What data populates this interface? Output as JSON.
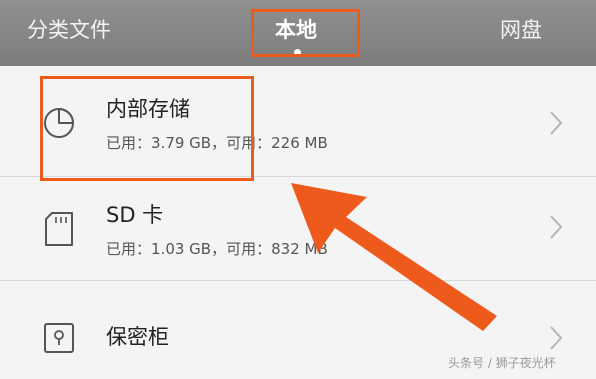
{
  "tabs": {
    "category": "分类文件",
    "local": "本地",
    "cloud": "网盘"
  },
  "storage_items": [
    {
      "title": "内部存储",
      "used_label": "已用：",
      "used": "3.79 GB",
      "sep": "，",
      "avail_label": "可用：",
      "available": "226 MB",
      "icon": "pie-chart-icon"
    },
    {
      "title": "SD 卡",
      "used_label": "已用：",
      "used": "1.03 GB",
      "sep": "，",
      "avail_label": "可用：",
      "available": "832 MB",
      "icon": "sd-card-icon"
    },
    {
      "title": "保密柜",
      "icon": "safe-lock-icon"
    }
  ],
  "watermark": "头条号 / 狮子夜光杯",
  "colors": {
    "topbar": "#858585",
    "highlight": "#ee5a1c",
    "background": "#f4f4f4"
  }
}
